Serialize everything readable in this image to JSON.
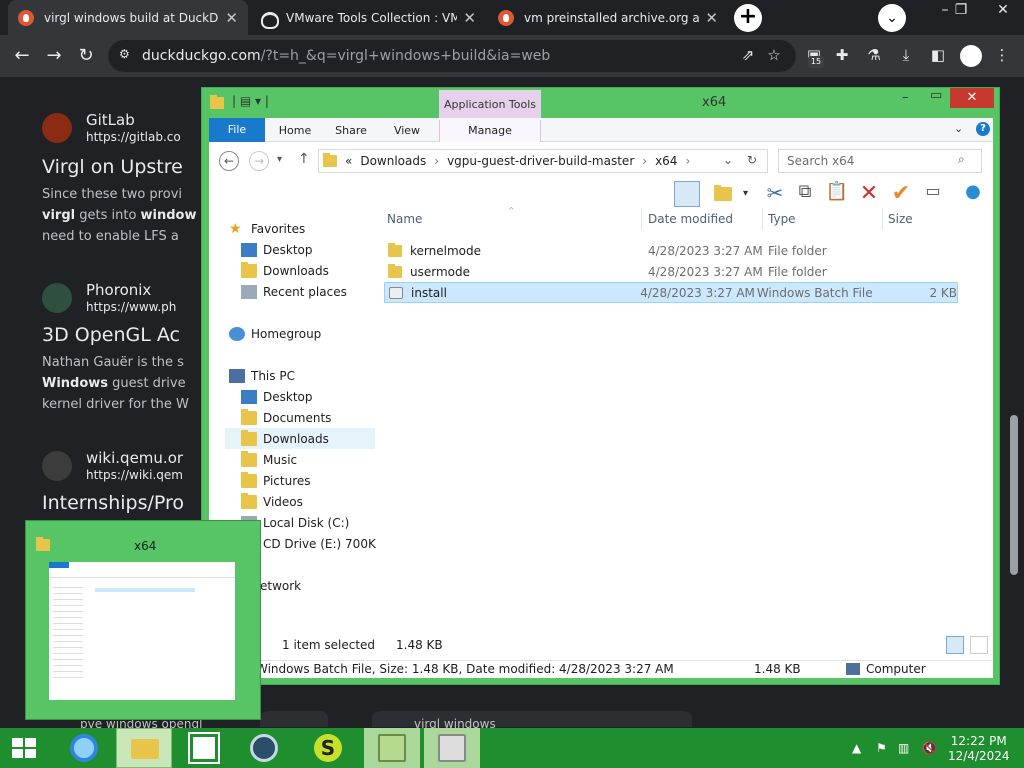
{
  "browser": {
    "tabs": [
      {
        "title": "virgl windows build at DuckDuck",
        "active": true
      },
      {
        "title": "VMware Tools Collection : VMw",
        "active": false
      },
      {
        "title": "vm preinstalled archive.org at D",
        "active": false
      }
    ],
    "new_tab": "+",
    "url_host": "duckduckgo.com",
    "url_path": "/?t=h_&q=virgl+windows+build&ia=web",
    "extension_badge": "15"
  },
  "results": [
    {
      "site": "GitLab",
      "url": "https://gitlab.co",
      "title": "Virgl on Upstre",
      "snippet_1": "Since these two provi",
      "snippet_2_bold": "virgl",
      "snippet_2_rest": " gets into ",
      "snippet_2_bold2": "window",
      "snippet_3": "need to enable LFS a"
    },
    {
      "site": "Phoronix",
      "url": "https://www.ph",
      "title": "3D OpenGL Ac",
      "snippet_1": "Nathan Gauër is the s",
      "snippet_2_bold": "Windows",
      "snippet_2_rest": " guest drive",
      "snippet_3": "kernel driver for the W"
    },
    {
      "site": "wiki.qemu.or",
      "url": "https://wiki.qem",
      "title": "Internships/Pro"
    }
  ],
  "partial_bottom": {
    "left": "pve windows opengl",
    "right": "virgl windows"
  },
  "explorer": {
    "title": "x64",
    "app_tools": "Application Tools",
    "ribbon_tabs": [
      "File",
      "Home",
      "Share",
      "View",
      "Manage"
    ],
    "breadcrumb": [
      "Downloads",
      "vgpu-guest-driver-build-master",
      "x64"
    ],
    "breadcrumb_prefix": "«",
    "search_placeholder": "Search x64",
    "columns": [
      "Name",
      "Date modified",
      "Type",
      "Size"
    ],
    "files": [
      {
        "name": "kernelmode",
        "date": "4/28/2023 3:27 AM",
        "type": "File folder",
        "size": "",
        "icon": "folder-icon",
        "selected": false
      },
      {
        "name": "usermode",
        "date": "4/28/2023 3:27 AM",
        "type": "File folder",
        "size": "",
        "icon": "folder-icon",
        "selected": false
      },
      {
        "name": "install",
        "date": "4/28/2023 3:27 AM",
        "type": "Windows Batch File",
        "size": "2 KB",
        "icon": "batch-file-icon",
        "selected": true
      }
    ],
    "nav_favorites": {
      "label": "Favorites",
      "items": [
        "Desktop",
        "Downloads",
        "Recent places"
      ]
    },
    "nav_homegroup": "Homegroup",
    "nav_thispc": {
      "label": "This PC",
      "items": [
        "Desktop",
        "Documents",
        "Downloads",
        "Music",
        "Pictures",
        "Videos",
        "Local Disk (C:)",
        "CD Drive (E:) 700K"
      ]
    },
    "nav_network": "Network",
    "items_selected": "1 item selected",
    "selected_size": "1.48 KB",
    "details": "Windows Batch File, Size: 1.48 KB, Date modified: 4/28/2023 3:27 AM",
    "details_size": "1.48 KB",
    "details_location": "Computer"
  },
  "thumbnail": {
    "title": "x64"
  },
  "taskbar": {
    "time": "12:22 PM",
    "date": "12/4/2024"
  },
  "colors": {
    "window_frame": "#57c466",
    "taskbar": "#1e8e2e",
    "accent": "#1979ca",
    "ddg": "#de5833"
  }
}
